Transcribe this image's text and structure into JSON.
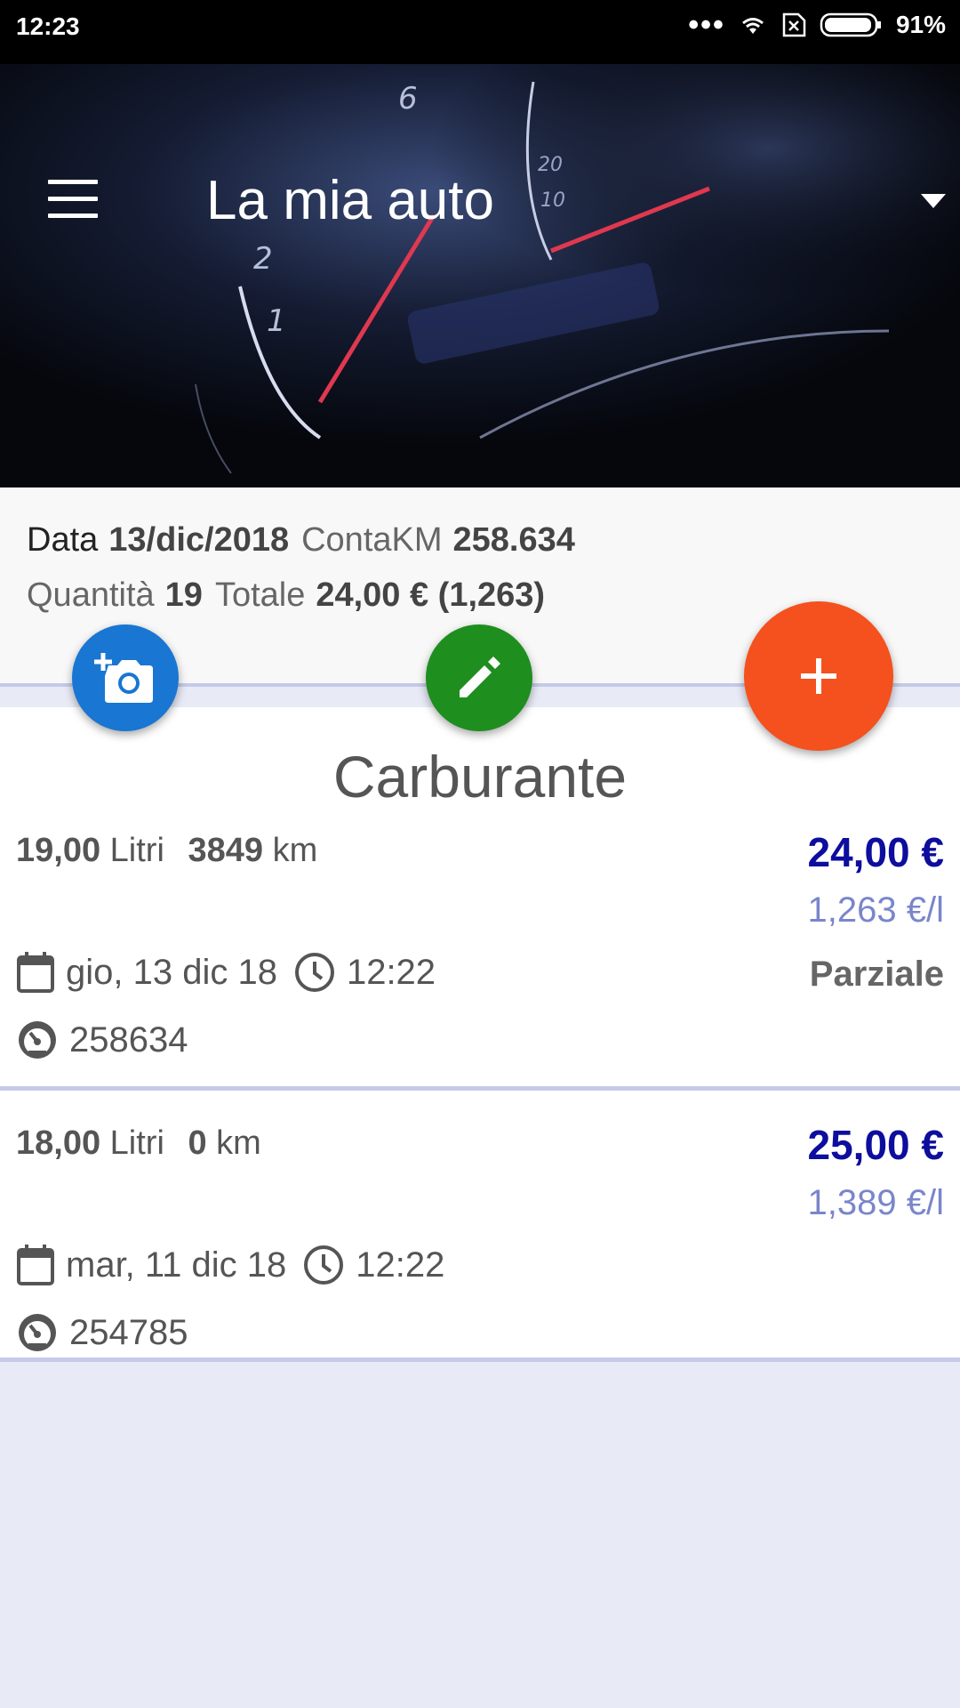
{
  "status": {
    "time": "12:23",
    "battery": "91%"
  },
  "header": {
    "title": "La mia auto"
  },
  "summary": {
    "data_label": "Data",
    "data_value": "13/dic/2018",
    "km_label": "ContaKM",
    "km_value": "258.634",
    "qty_label": "Quantità",
    "qty_value": "19",
    "total_label": "Totale",
    "total_value": "24,00 € (1,263)"
  },
  "section": {
    "title": "Carburante"
  },
  "entries": [
    {
      "quantity": "19,00",
      "quantity_unit": "Litri",
      "distance": "3849",
      "distance_unit": "km",
      "price": "24,00 €",
      "unit_price": "1,263 €/l",
      "date": "gio, 13 dic 18",
      "time": "12:22",
      "type": "Parziale",
      "odometer": "258634"
    },
    {
      "quantity": "18,00",
      "quantity_unit": "Litri",
      "distance": "0",
      "distance_unit": "km",
      "price": "25,00 €",
      "unit_price": "1,389 €/l",
      "date": "mar, 11 dic 18",
      "time": "12:22",
      "odometer": "254785"
    }
  ],
  "colors": {
    "accent_fab": "#f4511e",
    "camera_fab": "#1976d2",
    "edit_fab": "#1e8e1e",
    "price": "#0d0d9e",
    "unit_price": "#7986cb"
  },
  "icons": [
    "menu-icon",
    "dropdown-arrow-icon",
    "add-photo-icon",
    "edit-icon",
    "add-icon",
    "calendar-icon",
    "clock-icon",
    "speedometer-icon",
    "wifi-icon",
    "sim-icon",
    "battery-icon"
  ]
}
